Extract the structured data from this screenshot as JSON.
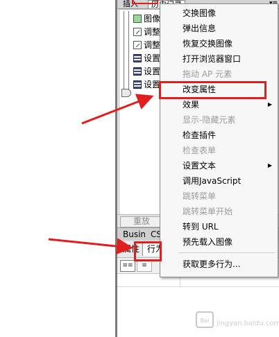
{
  "top_tabs": {
    "insert": "插入",
    "history": "历史记录",
    "menu_glyph": "▾≡"
  },
  "history": {
    "items": [
      {
        "label": "图像",
        "icon": "image-icon"
      },
      {
        "label": "调整",
        "icon": "resize-icon"
      },
      {
        "label": "调整",
        "icon": "resize-icon"
      },
      {
        "label": "设置",
        "icon": "set-text-icon"
      },
      {
        "label": "设置",
        "icon": "set-text-icon"
      },
      {
        "label": "设置",
        "icon": "set-text-icon"
      }
    ]
  },
  "replay_label": "重放",
  "panel_tabs": {
    "busin": "Busin",
    "css": "CS"
  },
  "behavior_tabs": {
    "attributes": "属性",
    "behaviors": "行为"
  },
  "toolbar": {
    "show_set_glyph": "≡≡",
    "show_all_glyph": "≡"
  },
  "menu": {
    "items": [
      {
        "label": "交换图像",
        "enabled": true,
        "submenu": false
      },
      {
        "label": "弹出信息",
        "enabled": true,
        "submenu": false
      },
      {
        "label": "恢复交换图像",
        "enabled": true,
        "submenu": false
      },
      {
        "label": "打开浏览器窗口",
        "enabled": true,
        "submenu": false
      },
      {
        "label": "拖动 AP 元素",
        "enabled": false,
        "submenu": false
      },
      {
        "label": "改变属性",
        "enabled": true,
        "submenu": false
      },
      {
        "label": "效果",
        "enabled": true,
        "submenu": true
      },
      {
        "label": "显示-隐藏元素",
        "enabled": false,
        "submenu": false
      },
      {
        "label": "检查插件",
        "enabled": true,
        "submenu": false
      },
      {
        "label": "检查表单",
        "enabled": false,
        "submenu": false
      },
      {
        "label": "设置文本",
        "enabled": true,
        "submenu": true
      },
      {
        "label": "调用JavaScript",
        "enabled": true,
        "submenu": false
      },
      {
        "label": "跳转菜单",
        "enabled": false,
        "submenu": false
      },
      {
        "label": "跳转菜单开始",
        "enabled": false,
        "submenu": false
      },
      {
        "label": "转到 URL",
        "enabled": true,
        "submenu": false
      },
      {
        "label": "预先载入图像",
        "enabled": true,
        "submenu": false
      },
      {
        "label": "获取更多行为...",
        "enabled": true,
        "submenu": false
      }
    ],
    "submenu_arrow": "▶"
  },
  "watermark": {
    "logo_text": "Bai",
    "site": "jingyan.baidu.com"
  },
  "colors": {
    "annotation": "#e01e1e",
    "menu_bg": "#f7f7f7",
    "disabled_text": "#9c9c9c"
  }
}
